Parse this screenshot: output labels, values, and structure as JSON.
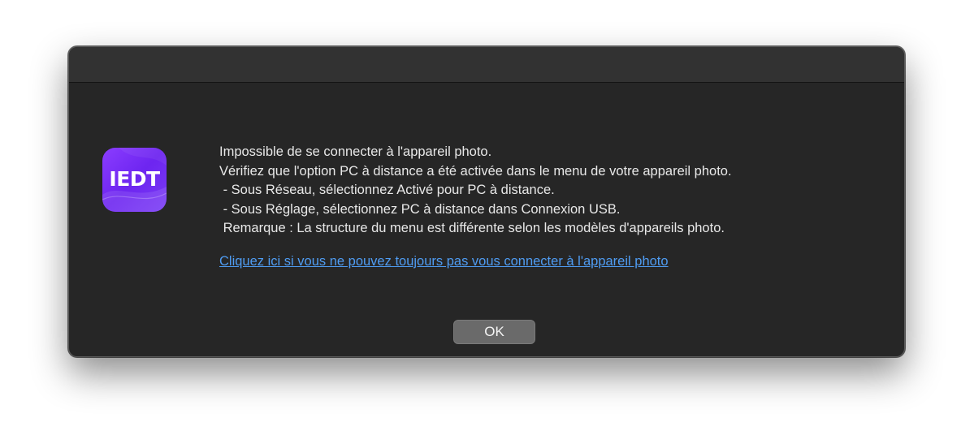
{
  "app_icon": {
    "label": "IEDT",
    "icon": "iedt-app-icon",
    "colors": [
      "#8b3dff",
      "#6d25f0"
    ]
  },
  "message": {
    "lines": [
      "Impossible de se connecter à l'appareil photo.",
      "Vérifiez que l'option PC à distance a été activée dans le menu de votre appareil photo.",
      " - Sous Réseau, sélectionnez Activé pour PC à distance.",
      " - Sous Réglage, sélectionnez PC à distance dans Connexion USB.",
      " Remarque : La structure du menu est différente selon les modèles d'appareils photo."
    ]
  },
  "help_link": {
    "label": "Cliquez ici si vous ne pouvez toujours pas vous connecter à l'appareil photo",
    "color": "#4f9cf2"
  },
  "buttons": {
    "ok_label": "OK"
  }
}
